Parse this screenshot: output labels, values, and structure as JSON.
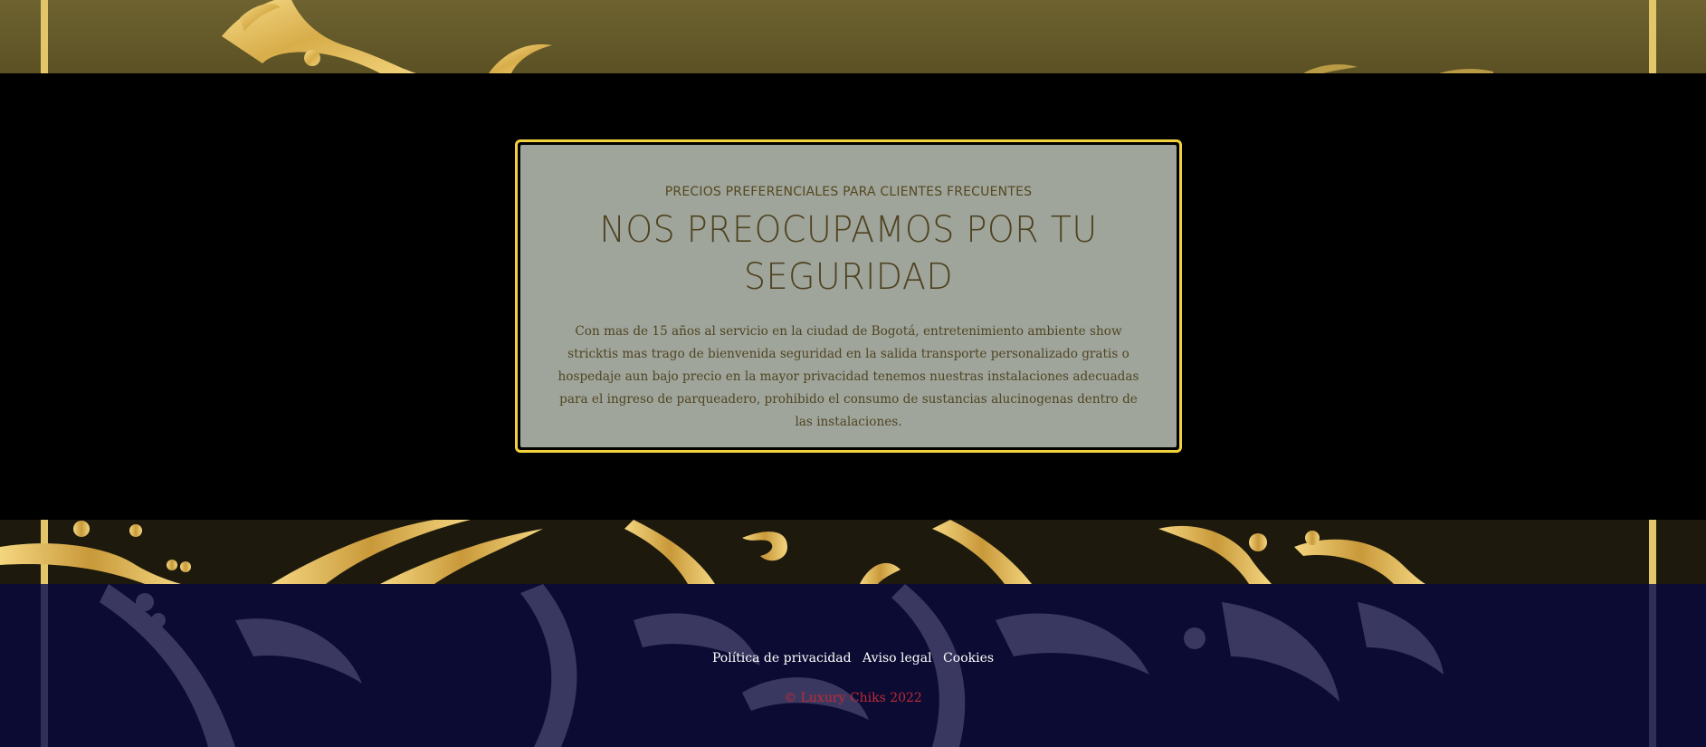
{
  "colors": {
    "card_border": "#f2d23c",
    "card_background": "#a0a59c",
    "text_brown": "#4e4320",
    "footer_background": "#0b0b33",
    "copyright_red": "#c02a35",
    "gold": "#e9c66a"
  },
  "card": {
    "eyebrow": "PRECIOS PREFERENCIALES PARA CLIENTES FRECUENTES",
    "headline": "NOS PREOCUPAMOS POR TU SEGURIDAD",
    "body": "Con mas de 15 años al servicio en la ciudad de Bogotá, entretenimiento ambiente show stricktis mas trago de bienvenida seguridad en la salida transporte personalizado gratis o hospedaje aun bajo precio en la mayor privacidad tenemos nuestras instalaciones adecuadas para el ingreso de parqueadero, prohibido el consumo de sustancias alucinogenas dentro de las instalaciones."
  },
  "footer": {
    "links": [
      "Política de privacidad",
      "Aviso legal",
      "Cookies"
    ],
    "copyright": "© Luxury Chiks 2022"
  }
}
